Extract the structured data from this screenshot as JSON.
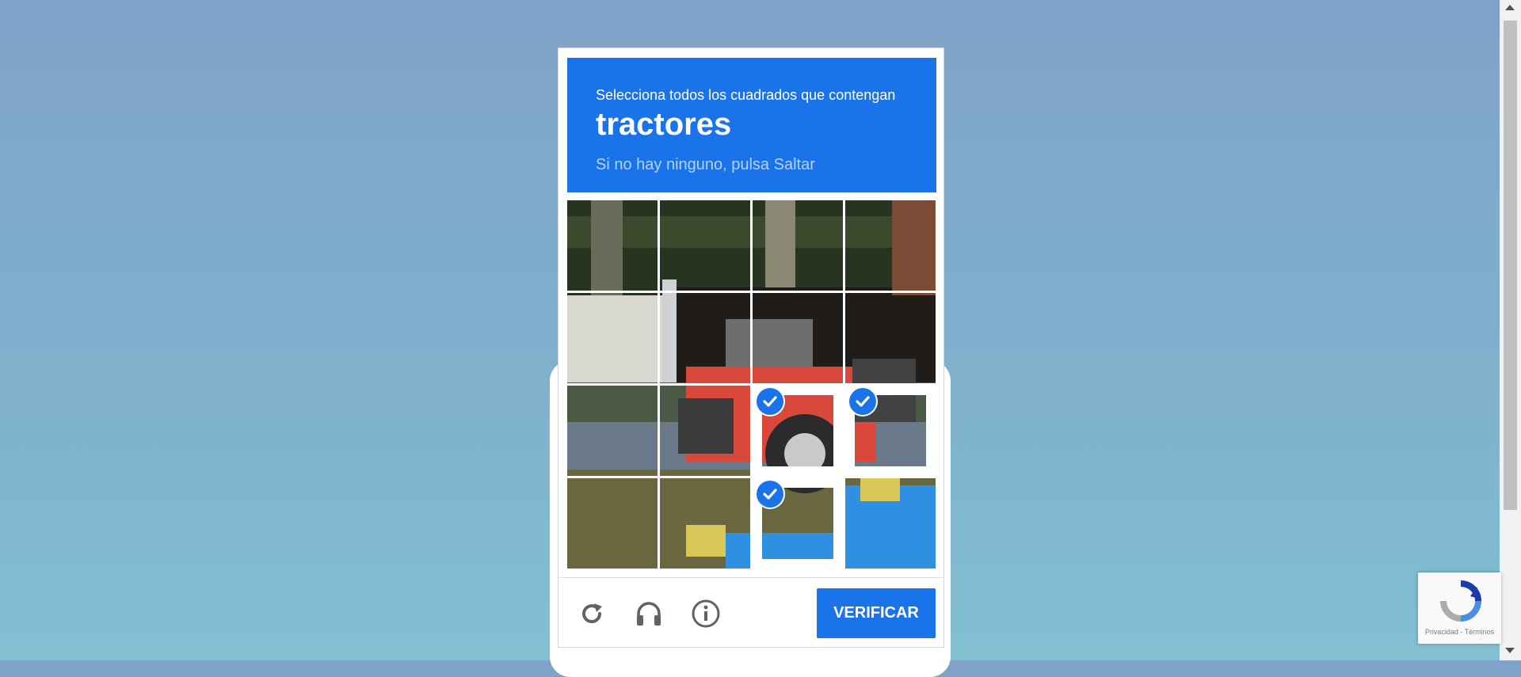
{
  "challenge": {
    "instruction": "Selecciona todos los cuadrados que contengan",
    "target": "tractores",
    "hint": "Si no hay ninguno, pulsa Saltar",
    "grid": {
      "rows": 4,
      "cols": 4,
      "tiles_selected": [
        false,
        false,
        false,
        false,
        false,
        false,
        false,
        false,
        false,
        false,
        true,
        true,
        false,
        false,
        true,
        false
      ]
    },
    "footer": {
      "reload_icon": "reload-icon",
      "audio_icon": "headphones-icon",
      "info_icon": "info-icon",
      "verify_label": "VERIFICAR"
    }
  },
  "badge": {
    "text": "Privacidad - Términos"
  },
  "colors": {
    "accent": "#1a73e8",
    "hint": "#b4d3f7",
    "tractor_red": "#d9483a",
    "tarp_blue": "#2f8fe0"
  }
}
